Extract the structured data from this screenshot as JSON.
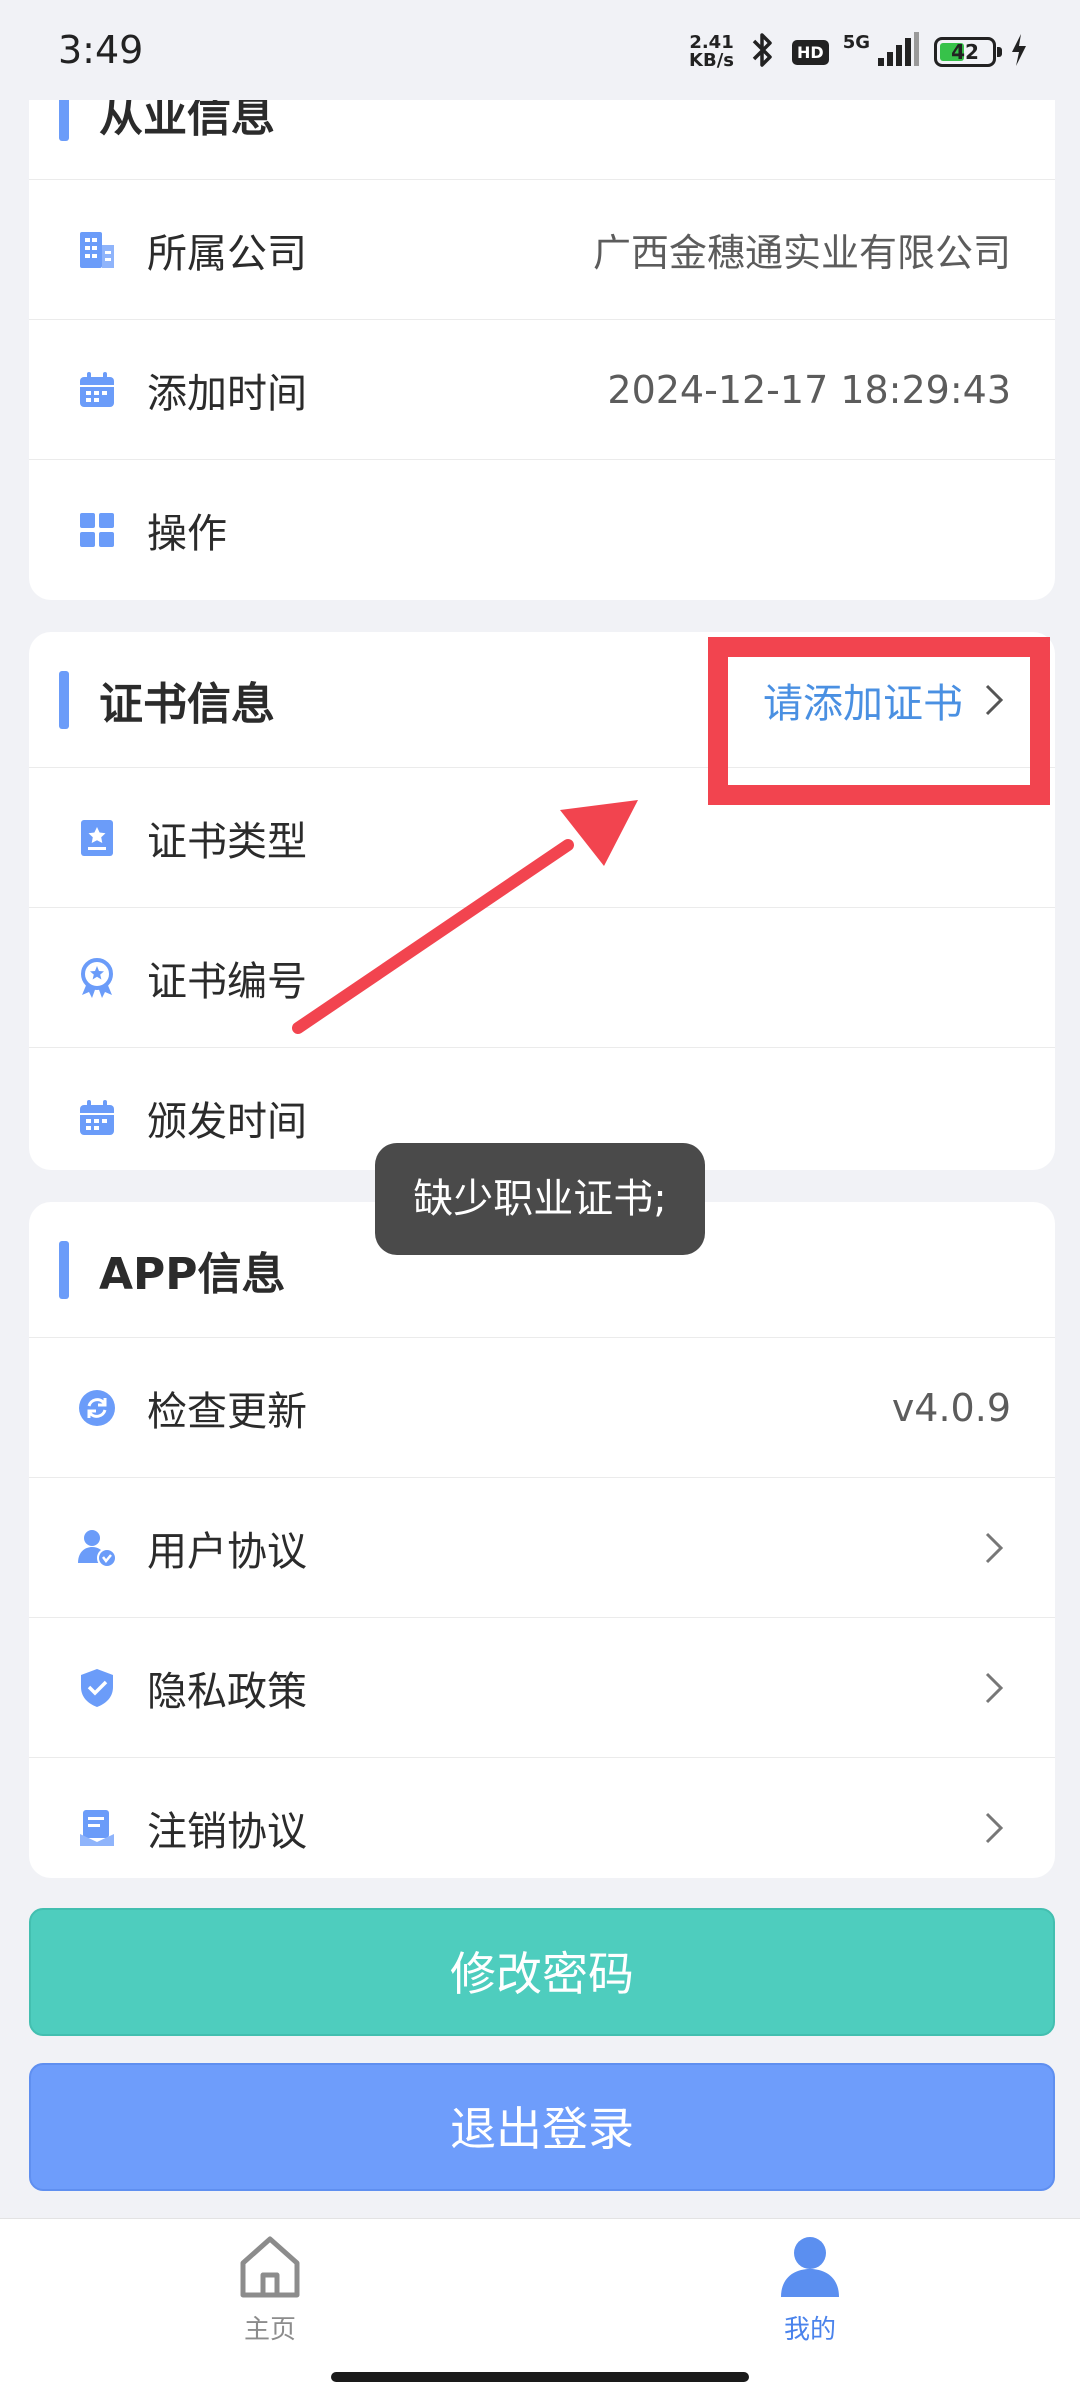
{
  "status_bar": {
    "time": "3:49",
    "net_speed_value": "2.41",
    "net_speed_unit": "KB/s",
    "hd_label": "HD",
    "network": "5G",
    "battery": "42"
  },
  "employment": {
    "title": "从业信息",
    "company_label": "所属公司",
    "company_value": "广西金穗通实业有限公司",
    "added_label": "添加时间",
    "added_value": "2024-12-17 18:29:43",
    "operation_label": "操作"
  },
  "certificate": {
    "title": "证书信息",
    "add_link": "请添加证书",
    "type_label": "证书类型",
    "number_label": "证书编号",
    "issue_label": "颁发时间"
  },
  "toast": "缺少职业证书;",
  "app_info": {
    "title": "APP信息",
    "update_label": "检查更新",
    "version": "v4.0.9",
    "user_agreement": "用户协议",
    "privacy_policy": "隐私政策",
    "cancel_agreement": "注销协议"
  },
  "buttons": {
    "change_password": "修改密码",
    "logout": "退出登录"
  },
  "nav": {
    "home": "主页",
    "mine": "我的"
  },
  "colors": {
    "accent": "#6b9cf9",
    "link": "#4a90e2",
    "green_button": "#4ecdbe",
    "blue_button": "#6e9dfb",
    "annotation": "#f2444f"
  }
}
